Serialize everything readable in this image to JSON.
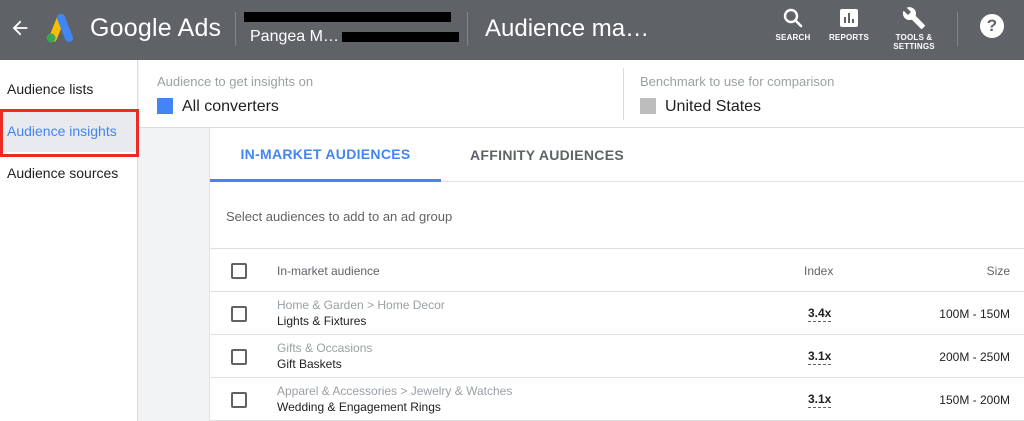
{
  "header": {
    "brand": "Google Ads",
    "account_name": "Pangea M…",
    "page_title": "Audience ma…",
    "actions": [
      {
        "icon": "search-icon",
        "label": "SEARCH"
      },
      {
        "icon": "reports-icon",
        "label": "REPORTS"
      },
      {
        "icon": "wrench-icon",
        "label_line1": "TOOLS &",
        "label_line2": "SETTINGS"
      }
    ],
    "help_glyph": "?",
    "colors": {
      "bar": "#5f6368",
      "logo_blue": "#4285f4",
      "logo_yellow": "#fbbc04",
      "logo_green": "#34a853"
    }
  },
  "sidebar": {
    "items": [
      {
        "label": "Audience lists",
        "active": false
      },
      {
        "label": "Audience insights",
        "active": true
      },
      {
        "label": "Audience sources",
        "active": false
      }
    ],
    "highlight_color": "#ee2a24"
  },
  "selection": {
    "left": {
      "label": "Audience to get insights on",
      "value": "All converters",
      "swatch_color": "#4285f4"
    },
    "right": {
      "label": "Benchmark to use for comparison",
      "value": "United States",
      "swatch_color": "#bdbdbd"
    }
  },
  "tabs": [
    {
      "label": "IN-MARKET AUDIENCES",
      "active": true
    },
    {
      "label": "AFFINITY AUDIENCES",
      "active": false
    }
  ],
  "hint": "Select audiences to add to an ad group",
  "table": {
    "columns": {
      "audience": "In-market audience",
      "index": "Index",
      "size": "Size"
    },
    "rows": [
      {
        "category": "Home & Garden > Home Decor",
        "name": "Lights & Fixtures",
        "index": "3.4x",
        "size": "100M - 150M"
      },
      {
        "category": "Gifts & Occasions",
        "name": "Gift Baskets",
        "index": "3.1x",
        "size": "200M - 250M"
      },
      {
        "category": "Apparel & Accessories > Jewelry & Watches",
        "name": "Wedding & Engagement Rings",
        "index": "3.1x",
        "size": "150M - 200M"
      }
    ]
  }
}
